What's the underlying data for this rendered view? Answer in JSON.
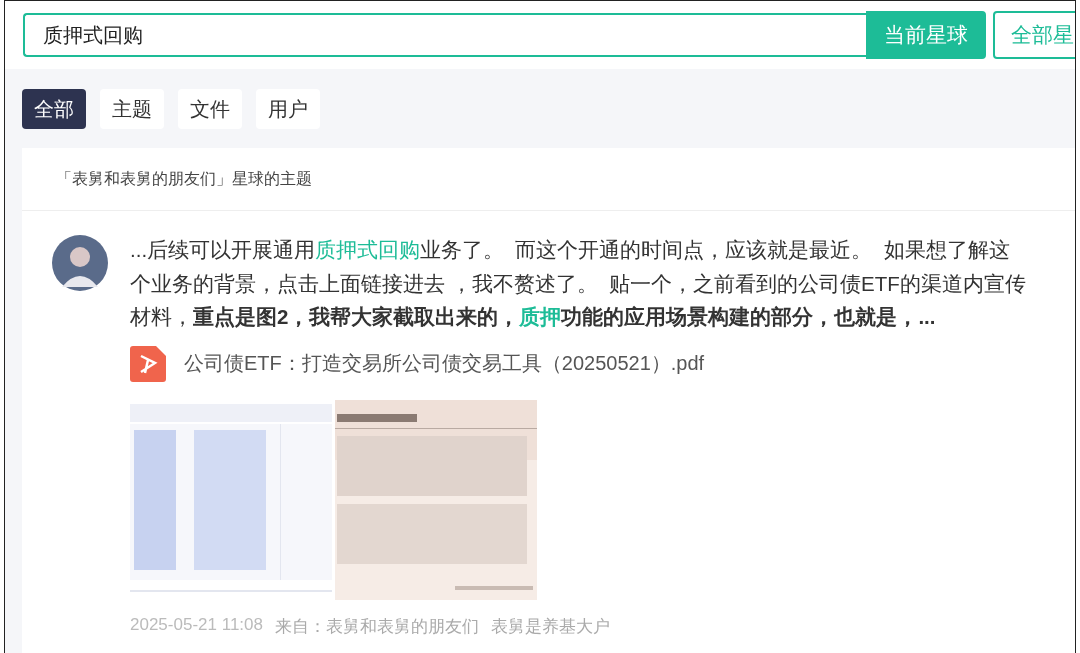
{
  "search": {
    "value": "质押式回购",
    "buttons": [
      {
        "label": "当前星球",
        "selected": true
      },
      {
        "label": "全部星",
        "selected": false
      }
    ]
  },
  "tabs": [
    {
      "label": "全部",
      "selected": true
    },
    {
      "label": "主题",
      "selected": false
    },
    {
      "label": "文件",
      "selected": false
    },
    {
      "label": "用户",
      "selected": false
    }
  ],
  "card": {
    "header": "「表舅和表舅的朋友们」星球的主题",
    "post": {
      "segments": [
        {
          "text": "...后续可以开展通用",
          "bold": false,
          "highlight": false
        },
        {
          "text": "质押式回购",
          "bold": false,
          "highlight": true
        },
        {
          "text": "业务了。  而这个开通的时间点，应该就是最近。  如果想了解这个业务的背景，点击上面链接进去 ，我不赘述了。  贴一个，之前看到的公司债ETF的渠道内宣传材料，",
          "bold": false,
          "highlight": false
        },
        {
          "text": "重点是图2，我帮大家截取出来的，",
          "bold": true,
          "highlight": false
        },
        {
          "text": "质押",
          "bold": true,
          "highlight": true
        },
        {
          "text": "功能的应用场景构建的部分，也就是，...",
          "bold": true,
          "highlight": false
        }
      ],
      "file": {
        "name": "公司债ETF：打造交易所公司债交易工具（20250521）.pdf"
      },
      "time": "2025-05-21 11:08",
      "source": "来自：表舅和表舅的朋友们",
      "author": "表舅是养基大户"
    }
  }
}
